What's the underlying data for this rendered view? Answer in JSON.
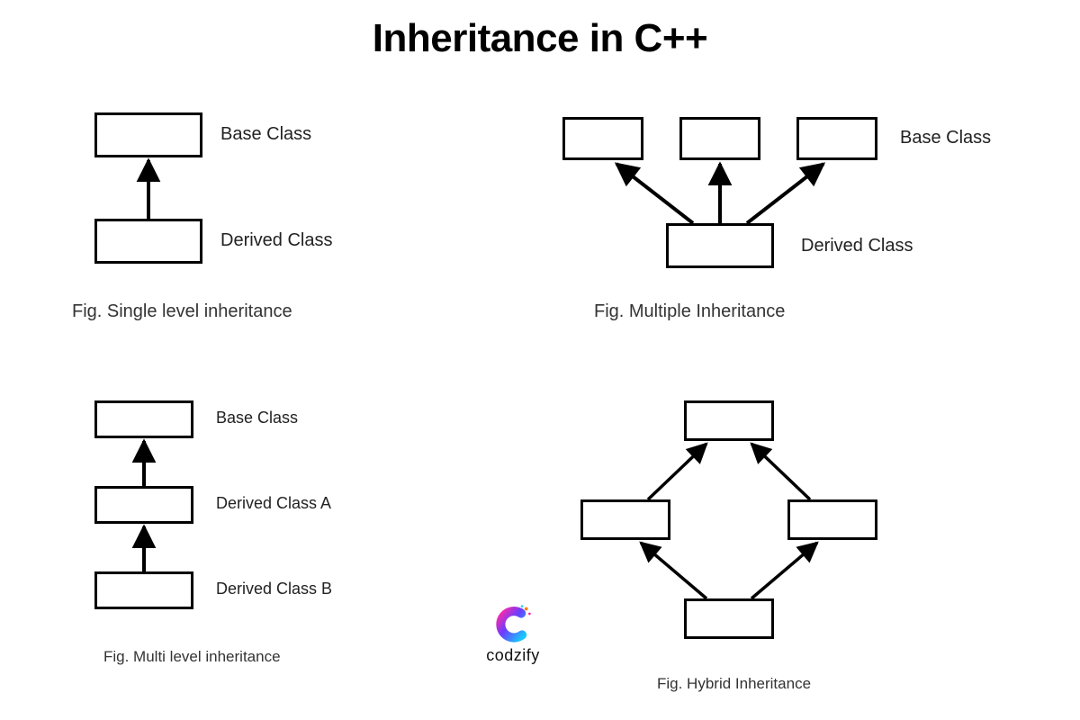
{
  "title": "Inheritance in C++",
  "brand": "codzify",
  "diagrams": {
    "single": {
      "caption": "Fig. Single level inheritance",
      "base_label": "Base Class",
      "derived_label": "Derived Class"
    },
    "multiple": {
      "caption": "Fig. Multiple Inheritance",
      "base_label": "Base Class",
      "derived_label": "Derived Class"
    },
    "multilevel": {
      "caption": "Fig. Multi level inheritance",
      "base_label": "Base Class",
      "derived_a_label": "Derived Class A",
      "derived_b_label": "Derived Class B"
    },
    "hybrid": {
      "caption": "Fig. Hybrid Inheritance"
    }
  }
}
